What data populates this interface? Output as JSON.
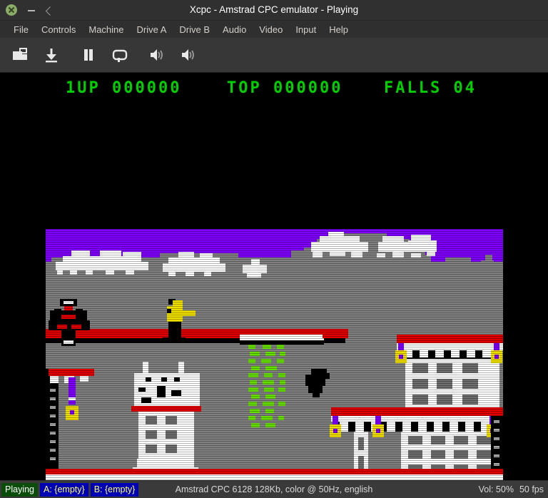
{
  "window": {
    "title": "Xcpc - Amstrad CPC emulator - Playing",
    "close_icon": "close-icon",
    "minimize_icon": "minimize-icon",
    "maximize_icon": "maximize-icon"
  },
  "menubar": {
    "items": [
      {
        "label": "File"
      },
      {
        "label": "Controls"
      },
      {
        "label": "Machine"
      },
      {
        "label": "Drive A"
      },
      {
        "label": "Drive B"
      },
      {
        "label": "Audio"
      },
      {
        "label": "Video"
      },
      {
        "label": "Input"
      },
      {
        "label": "Help"
      }
    ]
  },
  "toolbar": {
    "buttons": [
      {
        "name": "open-disk-button",
        "icon": "folder-open-icon",
        "tooltip": "Load"
      },
      {
        "name": "save-disk-button",
        "icon": "download-icon",
        "tooltip": "Save"
      },
      {
        "name": "pause-button",
        "icon": "pause-icon",
        "tooltip": "Pause"
      },
      {
        "name": "reset-button",
        "icon": "reset-loop-icon",
        "tooltip": "Reset"
      },
      {
        "name": "volume-decrease-button",
        "icon": "volume-low-icon",
        "tooltip": "Volume down"
      },
      {
        "name": "volume-increase-button",
        "icon": "volume-high-icon",
        "tooltip": "Volume up"
      }
    ]
  },
  "game": {
    "player_label": "1UP",
    "player_score": "000000",
    "top_label": "TOP",
    "top_score": "000000",
    "falls_label": "FALLS",
    "falls_value": "04",
    "palette": {
      "sky": "#8000ff",
      "cloud": "#ffffff",
      "ground": "#808080",
      "platform_red": "#e00000",
      "vine_green": "#66e000",
      "lantern_yellow": "#f0e000",
      "text_green": "#00d000",
      "black": "#000000"
    },
    "sprites": [
      {
        "name": "enemy-sprite",
        "color": "#000000"
      },
      {
        "name": "player-sprite",
        "color": "#f0e000"
      },
      {
        "name": "bird-sprite",
        "color": "#000000"
      },
      {
        "name": "bull-head-sprite",
        "color": "#ffffff"
      }
    ]
  },
  "statusbar": {
    "state": "Playing",
    "drive_a": "A: {empty}",
    "drive_b": "B: {empty}",
    "system": "Amstrad CPC 6128 128Kb, color @ 50Hz, english",
    "volume": "Vol: 50%",
    "fps": "50 fps"
  }
}
